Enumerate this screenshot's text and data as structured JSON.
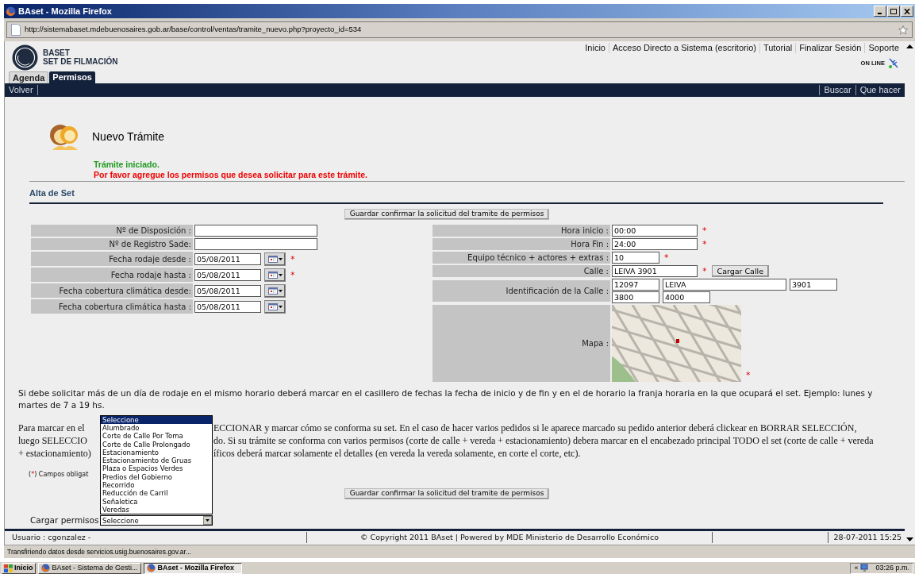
{
  "window": {
    "title": "BAset - Mozilla Firefox"
  },
  "address_bar": {
    "url": "http://sistemabaset.mdebuenosaires.gob.ar/base/control/ventas/tramite_nuevo.php?proyecto_id=534"
  },
  "header": {
    "logo_line1": "BASET",
    "logo_line2": "SET DE FILMACIÓN",
    "links": [
      "Inicio",
      "Acceso Directo a Sistema (escritorio)",
      "Tutorial",
      "Finalizar Sesión",
      "Soporte"
    ],
    "status": "ON LINE"
  },
  "tabs": [
    {
      "label": "Agenda",
      "selected": false
    },
    {
      "label": "Permisos",
      "selected": true
    }
  ],
  "nav": {
    "left": [
      "Volver"
    ],
    "right": [
      "Buscar",
      "Que hacer"
    ]
  },
  "page_title": "Nuevo Trámite",
  "messages": [
    {
      "kind": "success",
      "text": "Trámite iniciado."
    },
    {
      "kind": "error",
      "text": "Por favor agregue los permisos que desea solicitar para este trámite."
    }
  ],
  "section_title": "Alta de Set",
  "save_button_top": "Guardar confirmar la solicitud del tramite de permisos",
  "left_fields": [
    {
      "kind": "text",
      "label": "Nº de Disposición :"
    },
    {
      "kind": "text",
      "label": "Nº de Registro Sade:"
    },
    {
      "kind": "date",
      "label": "Fecha rodaje desde :",
      "value": "05/08/2011",
      "required_mark": "*"
    },
    {
      "kind": "date",
      "label": "Fecha rodaje hasta :",
      "value": "05/08/2011",
      "required_mark": "*"
    },
    {
      "kind": "date",
      "label": "Fecha cobertura climática desde:",
      "value": "05/08/2011"
    },
    {
      "kind": "date",
      "label": "Fecha cobertura climática hasta :",
      "value": "05/08/2011"
    }
  ],
  "right_fields": [
    {
      "kind": "text",
      "label": "Hora inicio :",
      "value": "00:00",
      "required_mark": "*"
    },
    {
      "kind": "text",
      "label": "Hora Fin :",
      "value": "24:00",
      "required_mark": "*"
    },
    {
      "kind": "short",
      "label": "Equipo técnico + actores + extras :",
      "value": "10",
      "required_mark": "*"
    },
    {
      "kind": "street",
      "label": "Calle :",
      "value": "LEIVA 3901",
      "required_mark": "*",
      "button": "Cargar Calle"
    },
    {
      "kind": "multi",
      "label": "Identificación de la Calle :",
      "values": [
        "12097",
        "LEIVA",
        "3901",
        "3800",
        "4000"
      ]
    },
    {
      "kind": "map",
      "label": "Mapa :",
      "required_mark": "*"
    }
  ],
  "help_text": "Si debe solicitar más de un día de rodaje en el mismo horario deberá marcar en el casillero de fechas la fecha de inicio y de fin y en el de horario la franja horaria en la que ocupará el set. Ejemplo: lunes y martes de 7 a 19 hs.",
  "paragraph_lines": [
    {
      "left": "Para marcar en el",
      "right": "ECCIONAR y marcar cómo se conforma su set. En el caso de hacer varios pedidos si le aparece marcado su pedido anterior deberá clickear en BORRAR SELECCIÓN,"
    },
    {
      "left": "luego SELECCIO",
      "right": "do. Si su trámite se conforma con varios permisos (corte de calle + vereda + estacionamiento) debera marcar en el encabezado principal TODO el set (corte de calle + vereda"
    },
    {
      "left": "+ estacionamiento)",
      "right": "íficos deberá marcar solamente el detalles (en vereda la vereda solamente, en corte el corte, etc)."
    }
  ],
  "required_note": {
    "open": "(",
    "mark": "*",
    "text": ") Campos obligat"
  },
  "save_button_bottom": "Guardar confirmar la solicitud del tramite de permisos",
  "permisos_select": {
    "label": "Cargar permisos",
    "value": "Seleccione",
    "expanded": true,
    "options": [
      {
        "label": "Seleccione",
        "selected": true
      },
      {
        "label": "Alumbrado",
        "selected": false
      },
      {
        "label": "Corte de Calle Por Toma",
        "selected": false
      },
      {
        "label": "Corte de Calle Prolongado",
        "selected": false
      },
      {
        "label": "Estacionamiento",
        "selected": false
      },
      {
        "label": "Estacionamiento de Gruas",
        "selected": false
      },
      {
        "label": "Plaza o Espacios Verdes",
        "selected": false
      },
      {
        "label": "Predios del Gobierno",
        "selected": false
      },
      {
        "label": "Recorrido",
        "selected": false
      },
      {
        "label": "Reducción de Carril",
        "selected": false
      },
      {
        "label": "Señaletica",
        "selected": false
      },
      {
        "label": "Veredas",
        "selected": false
      }
    ]
  },
  "footer": {
    "user": "Usuario : cgonzalez -",
    "copyright": "© Copyright 2011 BAset | Powered by MDE Ministerio de Desarrollo Económico",
    "datetime": "28-07-2011 15:25"
  },
  "status_bar": "Transfiriendo datos desde servicios.usig.buenosaires.gov.ar...",
  "taskbar": {
    "start": "Inicio",
    "tasks": [
      {
        "label": "BAset - Sistema de Gesti...",
        "selected": false
      },
      {
        "label": "BAset - Mozilla Firefox",
        "selected": true
      }
    ],
    "tray_arrow": "«",
    "clock": "03:26 p.m."
  }
}
